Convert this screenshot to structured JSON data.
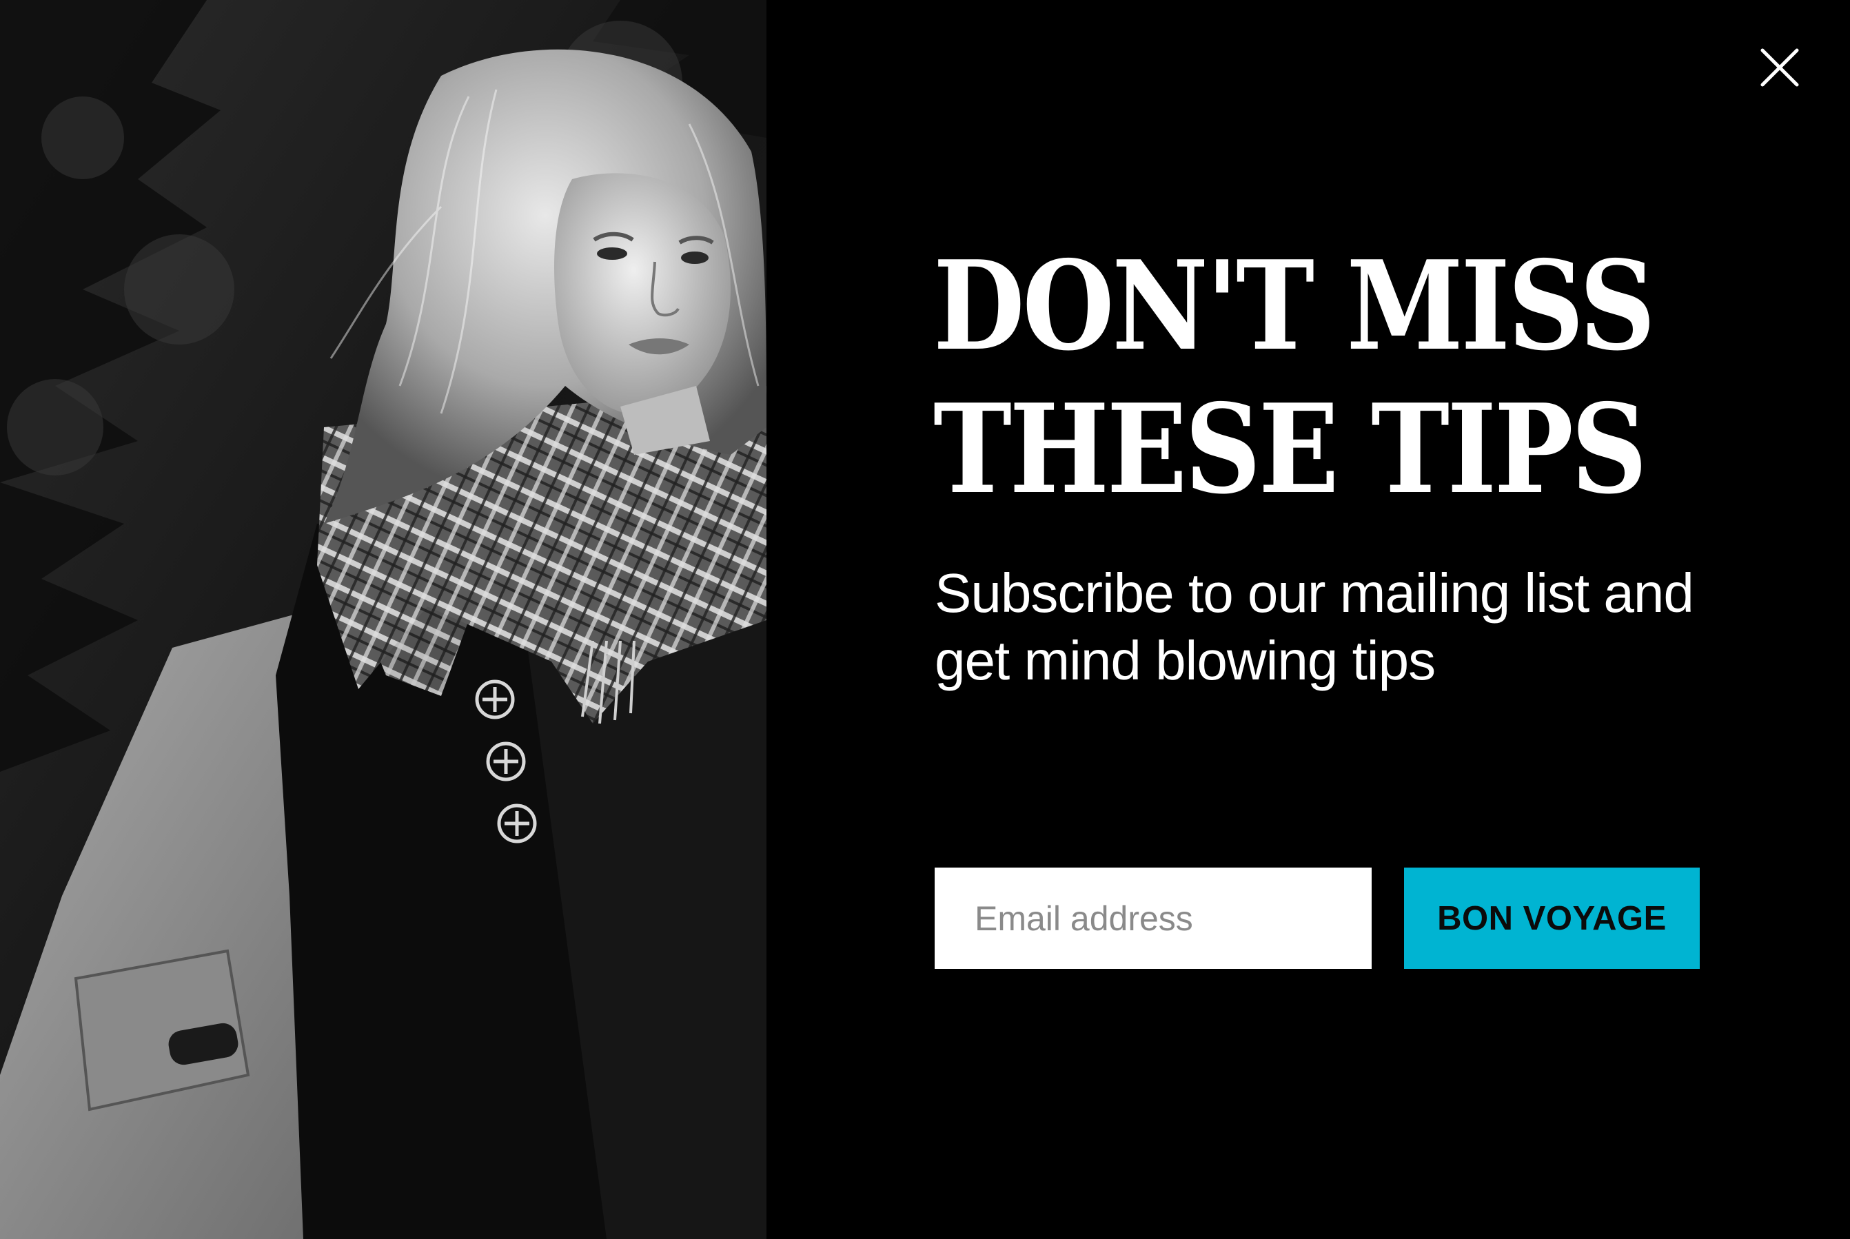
{
  "popup": {
    "close_icon": "close-icon",
    "headline": {
      "line1": "DON'T MISS",
      "line2": "THESE TIPS"
    },
    "subtitle": "Subscribe to our mailing list and get mind blowing tips",
    "email": {
      "placeholder": "Email address",
      "value": ""
    },
    "submit_label": "BON VOYAGE",
    "colors": {
      "background": "#000000",
      "text": "#ffffff",
      "button": "#00b4d2",
      "button_text": "#0b0b0b"
    },
    "photo": {
      "subject": "woman-with-scarf-and-backpack",
      "style": "black-and-white"
    }
  }
}
